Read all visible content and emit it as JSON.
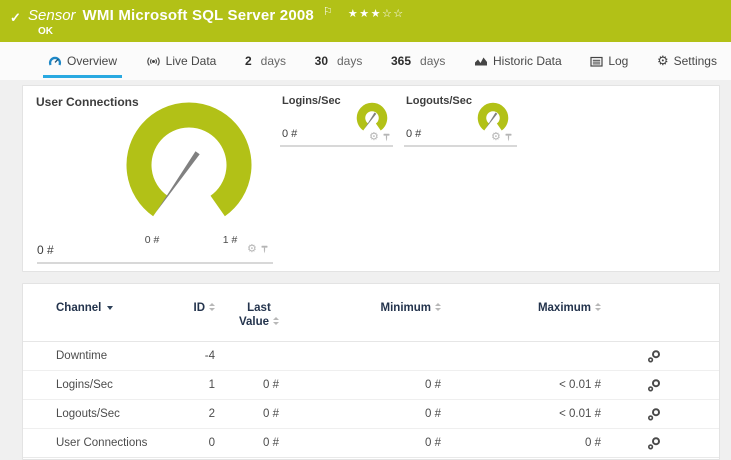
{
  "colors": {
    "brand_green": "#b2c117",
    "accent_blue": "#29a9e1",
    "gauge_green": "#b2c117"
  },
  "header": {
    "check_icon": "✓",
    "kind": "Sensor",
    "title": "WMI Microsoft SQL Server 2008",
    "flag_icon": "⚐",
    "stars_filled": "★★★",
    "stars_empty": "☆☆",
    "status": "OK"
  },
  "tabs": [
    {
      "label": "Overview",
      "icon": "gauge-icon",
      "active": true
    },
    {
      "label": "Live Data",
      "icon": "broadcast-icon"
    },
    {
      "num": "2",
      "label": "days"
    },
    {
      "num": "30",
      "label": "days"
    },
    {
      "num": "365",
      "label": "days"
    },
    {
      "label": "Historic Data",
      "icon": "area-chart-icon"
    },
    {
      "label": "Log",
      "icon": "log-icon"
    },
    {
      "label": "Settings",
      "icon": "gear-icon"
    }
  ],
  "icons": {
    "gear": "⚙"
  },
  "gauges": {
    "main": {
      "title": "User Connections",
      "value": "0 #",
      "scale_min": "0 #",
      "scale_max": "1 #"
    },
    "small": [
      {
        "title": "Logins/Sec",
        "value": "0 #"
      },
      {
        "title": "Logouts/Sec",
        "value": "0 #"
      }
    ]
  },
  "table": {
    "columns": {
      "channel": "Channel",
      "id": "ID",
      "last_1": "Last",
      "last_2": "Value",
      "minimum": "Minimum",
      "maximum": "Maximum"
    },
    "rows": [
      {
        "channel": "Downtime",
        "id": "-4",
        "last": "",
        "min": "",
        "max": ""
      },
      {
        "channel": "Logins/Sec",
        "id": "1",
        "last": "0 #",
        "min": "0 #",
        "max": "< 0.01 #"
      },
      {
        "channel": "Logouts/Sec",
        "id": "2",
        "last": "0 #",
        "min": "0 #",
        "max": "< 0.01 #"
      },
      {
        "channel": "User Connections",
        "id": "0",
        "last": "0 #",
        "min": "0 #",
        "max": "0 #"
      }
    ]
  }
}
